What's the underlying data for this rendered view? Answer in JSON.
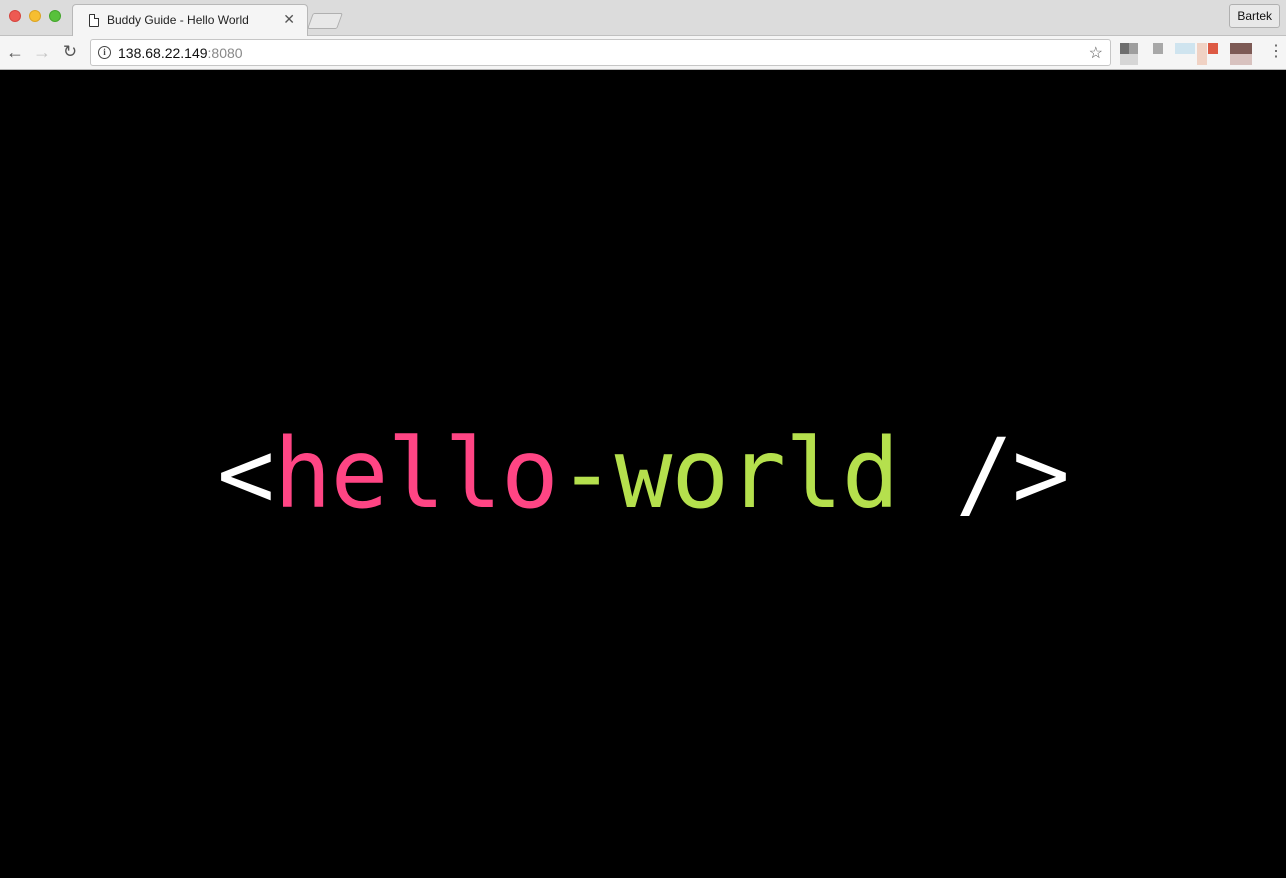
{
  "browser": {
    "tab": {
      "title": "Buddy Guide - Hello World",
      "icon": "document-icon",
      "close_glyph": "✕"
    },
    "profile_button": "Bartek",
    "nav": {
      "back_glyph": "←",
      "forward_glyph": "→",
      "reload_glyph": "↻"
    },
    "address": {
      "host": "138.68.22.149",
      "port": ":8080",
      "info_glyph": "i"
    },
    "star_glyph": "☆",
    "menu_glyph": "⋮"
  },
  "page": {
    "open_bracket": "<",
    "word1": "hello",
    "word2": "-world",
    "close_tag": " />",
    "colors": {
      "bracket": "#ffffff",
      "word1": "#ff4584",
      "word2": "#b5e04d",
      "background": "#000000"
    }
  }
}
